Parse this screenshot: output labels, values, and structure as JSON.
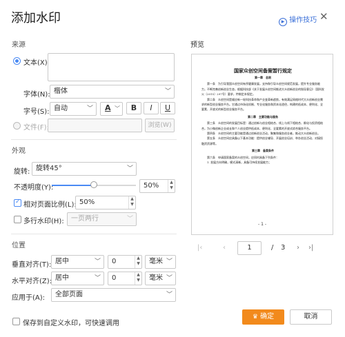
{
  "dialog": {
    "title": "添加水印",
    "tips_label": "操作技巧"
  },
  "source": {
    "section": "来源",
    "text_label": "文本(X):",
    "text_value": "",
    "font_label": "字体(N):",
    "font_value": "楷体",
    "size_label": "字号(S):",
    "size_value": "自动",
    "bold": "B",
    "italic": "I",
    "underline": "U",
    "color_glyph": "A",
    "file_label": "文件(F):",
    "browse_label": "浏览(W)"
  },
  "appearance": {
    "section": "外观",
    "rotate_label": "旋转:",
    "rotate_value": "旋转45°",
    "opacity_label": "不透明度(Y):",
    "opacity_value": "50%",
    "opacity_fraction": 0.5,
    "relative_label": "相对页面比例(L):",
    "relative_value": "50%",
    "relative_checked": true,
    "multiline_label": "多行水印(H):",
    "multiline_value": "一页两行",
    "multiline_checked": false
  },
  "position": {
    "section": "位置",
    "valign_label": "垂直对齐(T):",
    "valign_value": "居中",
    "valign_offset": "0",
    "valign_unit": "毫米",
    "halign_label": "水平对齐(Z):",
    "halign_value": "居中",
    "halign_offset": "0",
    "halign_unit": "毫米",
    "apply_label": "应用于(A):",
    "apply_value": "全部页面"
  },
  "footer": {
    "save_label": "保存到自定义水印，可快速调用",
    "ok_label": "确定",
    "cancel_label": "取消"
  },
  "preview": {
    "label": "预览",
    "page_current": "1",
    "page_sep": "/",
    "page_total": "3",
    "doc_title": "国家众创空间备案暂行规定",
    "chapter1": "第一章　总则",
    "chapter2": "第二章　主要功能与服务",
    "chapter3": "第三章　备案条件",
    "page_no": "- 1 -",
    "paragraphs": [
      "第一条　为引导我国众创空间有序健康发展，支持和引导众创空间规范发展，提升专业服务能力，不断完善创新创业生态，根据科技部《关于发展众创空间推进大众创新创业的指导意见》（国科发火〔2015〕297号）要求，特制定本规定。",
      "第二条　众创空间是顺应新一轮科技革命和产业变革新趋势，有效满足网络时代大众创新创业需求的新型创业服务平台。它通过市场化机制、专业化服务和资本化途径，构建的低成本、便利化、全要素、开放式的新型创业服务平台。",
      "第三条　众创空间的发展目标是：通过创新与创业相结合、线上与线下相结合、孵化与投资相结合，为小微创新企业成长和个人创业提供低成本、便利化、全要素的开放式综合服务平台。",
      "第四条　众创空间的主要功能是通过创新创业活动，聚集和服务创业者，推动大众创新创业。",
      "第五条　众创空间应具备以下基本功能：提供创业辅导、开展创业培训、举办创业活动、对接投融资资源等。",
      "第六条　申请国家备案的众创空间，应同时具备下列条件：",
      "1. 发展方向明确，模式清晰，具备可持续发展能力；"
    ]
  }
}
